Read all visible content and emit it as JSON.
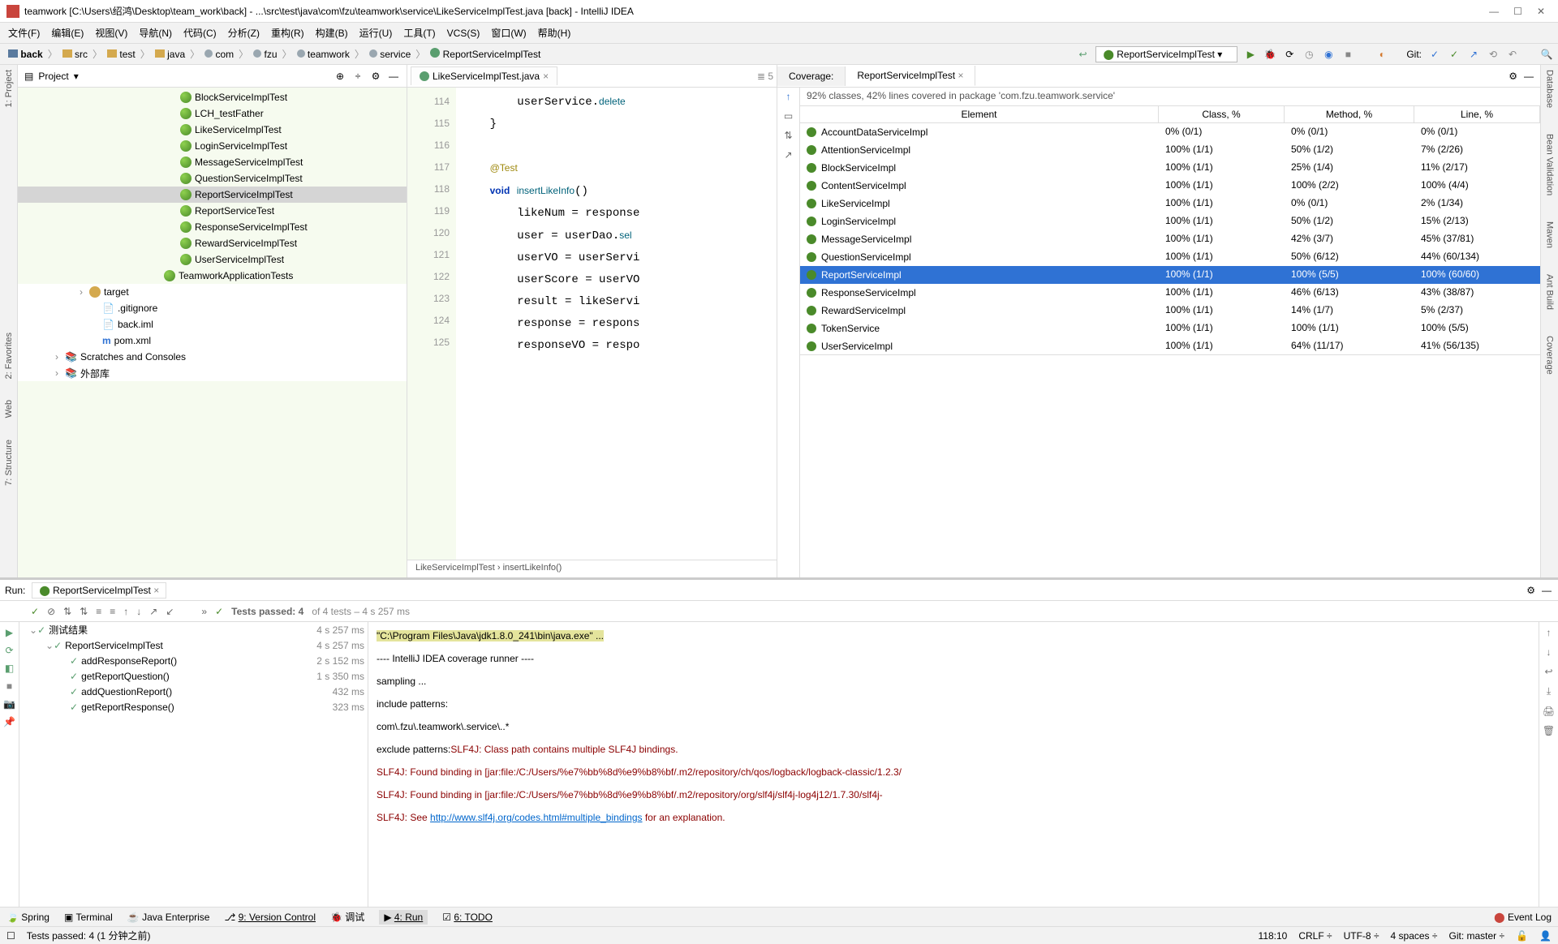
{
  "title": "teamwork [C:\\Users\\绍鸿\\Desktop\\team_work\\back] - ...\\src\\test\\java\\com\\fzu\\teamwork\\service\\LikeServiceImplTest.java [back] - IntelliJ IDEA",
  "menu": [
    "文件(F)",
    "编辑(E)",
    "视图(V)",
    "导航(N)",
    "代码(C)",
    "分析(Z)",
    "重构(R)",
    "构建(B)",
    "运行(U)",
    "工具(T)",
    "VCS(S)",
    "窗口(W)",
    "帮助(H)"
  ],
  "breadcrumb": [
    "back",
    "src",
    "test",
    "java",
    "com",
    "fzu",
    "teamwork",
    "service",
    "ReportServiceImplTest"
  ],
  "runConfig": "ReportServiceImplTest",
  "gitLabel": "Git:",
  "leftTabs": [
    "1: Project"
  ],
  "rightTabs": [
    "Database",
    "Bean Validation",
    "Maven",
    "Ant Build",
    "Coverage"
  ],
  "project": {
    "header": "Project",
    "items": [
      {
        "name": "BlockServiceImplTest",
        "indent": 200
      },
      {
        "name": "LCH_testFather",
        "indent": 200
      },
      {
        "name": "LikeServiceImplTest",
        "indent": 200
      },
      {
        "name": "LoginServiceImplTest",
        "indent": 200
      },
      {
        "name": "MessageServiceImplTest",
        "indent": 200
      },
      {
        "name": "QuestionServiceImplTest",
        "indent": 200
      },
      {
        "name": "ReportServiceImplTest",
        "indent": 200,
        "selected": true
      },
      {
        "name": "ReportServiceTest",
        "indent": 200
      },
      {
        "name": "ResponseServiceImplTest",
        "indent": 200
      },
      {
        "name": "RewardServiceImplTest",
        "indent": 200
      },
      {
        "name": "UserServiceImplTest",
        "indent": 200
      },
      {
        "name": "TeamworkApplicationTests",
        "indent": 180
      },
      {
        "name": "target",
        "indent": 90,
        "folder": true,
        "arrow": true
      },
      {
        "name": ".gitignore",
        "indent": 104,
        "file": true
      },
      {
        "name": "back.iml",
        "indent": 104,
        "file": true
      },
      {
        "name": "pom.xml",
        "indent": 104,
        "file": true,
        "maven": true
      },
      {
        "name": "Scratches and Consoles",
        "indent": 60,
        "lib": true,
        "arrow": true
      },
      {
        "name": "外部库",
        "indent": 60,
        "lib": true,
        "arrow": true
      }
    ]
  },
  "editor": {
    "tab": "LikeServiceImplTest.java",
    "indicator": "≣ 5",
    "lines": [
      "114",
      "115",
      "116",
      "117",
      "118",
      "119",
      "120",
      "121",
      "122",
      "123",
      "124",
      "125"
    ],
    "crumb": "LikeServiceImplTest  ›  insertLikeInfo()"
  },
  "coverage": {
    "tab1": "Coverage:",
    "tab2": "ReportServiceImplTest",
    "summary": "92% classes, 42% lines covered in package 'com.fzu.teamwork.service'",
    "headers": [
      "Element",
      "Class, %",
      "Method, %",
      "Line, %"
    ],
    "rows": [
      {
        "el": "AccountDataServiceImpl",
        "cl": "0% (0/1)",
        "me": "0% (0/1)",
        "li": "0% (0/1)"
      },
      {
        "el": "AttentionServiceImpl",
        "cl": "100% (1/1)",
        "me": "50% (1/2)",
        "li": "7% (2/26)"
      },
      {
        "el": "BlockServiceImpl",
        "cl": "100% (1/1)",
        "me": "25% (1/4)",
        "li": "11% (2/17)"
      },
      {
        "el": "ContentServiceImpl",
        "cl": "100% (1/1)",
        "me": "100% (2/2)",
        "li": "100% (4/4)"
      },
      {
        "el": "LikeServiceImpl",
        "cl": "100% (1/1)",
        "me": "0% (0/1)",
        "li": "2% (1/34)"
      },
      {
        "el": "LoginServiceImpl",
        "cl": "100% (1/1)",
        "me": "50% (1/2)",
        "li": "15% (2/13)"
      },
      {
        "el": "MessageServiceImpl",
        "cl": "100% (1/1)",
        "me": "42% (3/7)",
        "li": "45% (37/81)"
      },
      {
        "el": "QuestionServiceImpl",
        "cl": "100% (1/1)",
        "me": "50% (6/12)",
        "li": "44% (60/134)"
      },
      {
        "el": "ReportServiceImpl",
        "cl": "100% (1/1)",
        "me": "100% (5/5)",
        "li": "100% (60/60)",
        "selected": true
      },
      {
        "el": "ResponseServiceImpl",
        "cl": "100% (1/1)",
        "me": "46% (6/13)",
        "li": "43% (38/87)"
      },
      {
        "el": "RewardServiceImpl",
        "cl": "100% (1/1)",
        "me": "14% (1/7)",
        "li": "5% (2/37)"
      },
      {
        "el": "TokenService",
        "cl": "100% (1/1)",
        "me": "100% (1/1)",
        "li": "100% (5/5)"
      },
      {
        "el": "UserServiceImpl",
        "cl": "100% (1/1)",
        "me": "64% (11/17)",
        "li": "41% (56/135)"
      }
    ]
  },
  "run": {
    "tabLabel": "Run:",
    "tabName": "ReportServiceImplTest",
    "testsPassed": "Tests passed: 4",
    "testsMeta": " of 4 tests – 4 s 257 ms",
    "tree": [
      {
        "name": "测试结果",
        "time": "4 s 257 ms",
        "indent": 8,
        "arrow": true
      },
      {
        "name": "ReportServiceImplTest",
        "time": "4 s 257 ms",
        "indent": 28,
        "arrow": true
      },
      {
        "name": "addResponseReport()",
        "time": "2 s 152 ms",
        "indent": 58
      },
      {
        "name": "getReportQuestion()",
        "time": "1 s 350 ms",
        "indent": 58
      },
      {
        "name": "addQuestionReport()",
        "time": "432 ms",
        "indent": 58
      },
      {
        "name": "getReportResponse()",
        "time": "323 ms",
        "indent": 58
      }
    ],
    "out": {
      "l1": "\"C:\\Program Files\\Java\\jdk1.8.0_241\\bin\\java.exe\" ...",
      "l2": "---- IntelliJ IDEA coverage runner ----",
      "l3": "sampling ...",
      "l4": "include patterns:",
      "l5": "com\\.fzu\\.teamwork\\.service\\..*",
      "l6a": "exclude patterns:",
      "l6b": "SLF4J: Class path contains multiple SLF4J bindings.",
      "l7": "SLF4J: Found binding in [jar:file:/C:/Users/%e7%bb%8d%e9%b8%bf/.m2/repository/ch/qos/logback/logback-classic/1.2.3/",
      "l8": "SLF4J: Found binding in [jar:file:/C:/Users/%e7%bb%8d%e9%b8%bf/.m2/repository/org/slf4j/slf4j-log4j12/1.7.30/slf4j-",
      "l9a": "SLF4J: See ",
      "l9b": "http://www.slf4j.org/codes.html#multiple_bindings",
      "l9c": " for an explanation."
    }
  },
  "bottom": {
    "items": [
      "Spring",
      "Terminal",
      "Java Enterprise",
      "9: Version Control",
      "调试",
      "4: Run",
      "6: TODO"
    ],
    "event": "Event Log"
  },
  "status": {
    "msg": "Tests passed: 4 (1 分钟之前)",
    "pos": "118:10",
    "eol": "CRLF",
    "enc": "UTF-8",
    "indent": "4 spaces",
    "git": "Git: master"
  },
  "leftFavs": [
    "2: Favorites",
    "Web",
    "7: Structure"
  ]
}
